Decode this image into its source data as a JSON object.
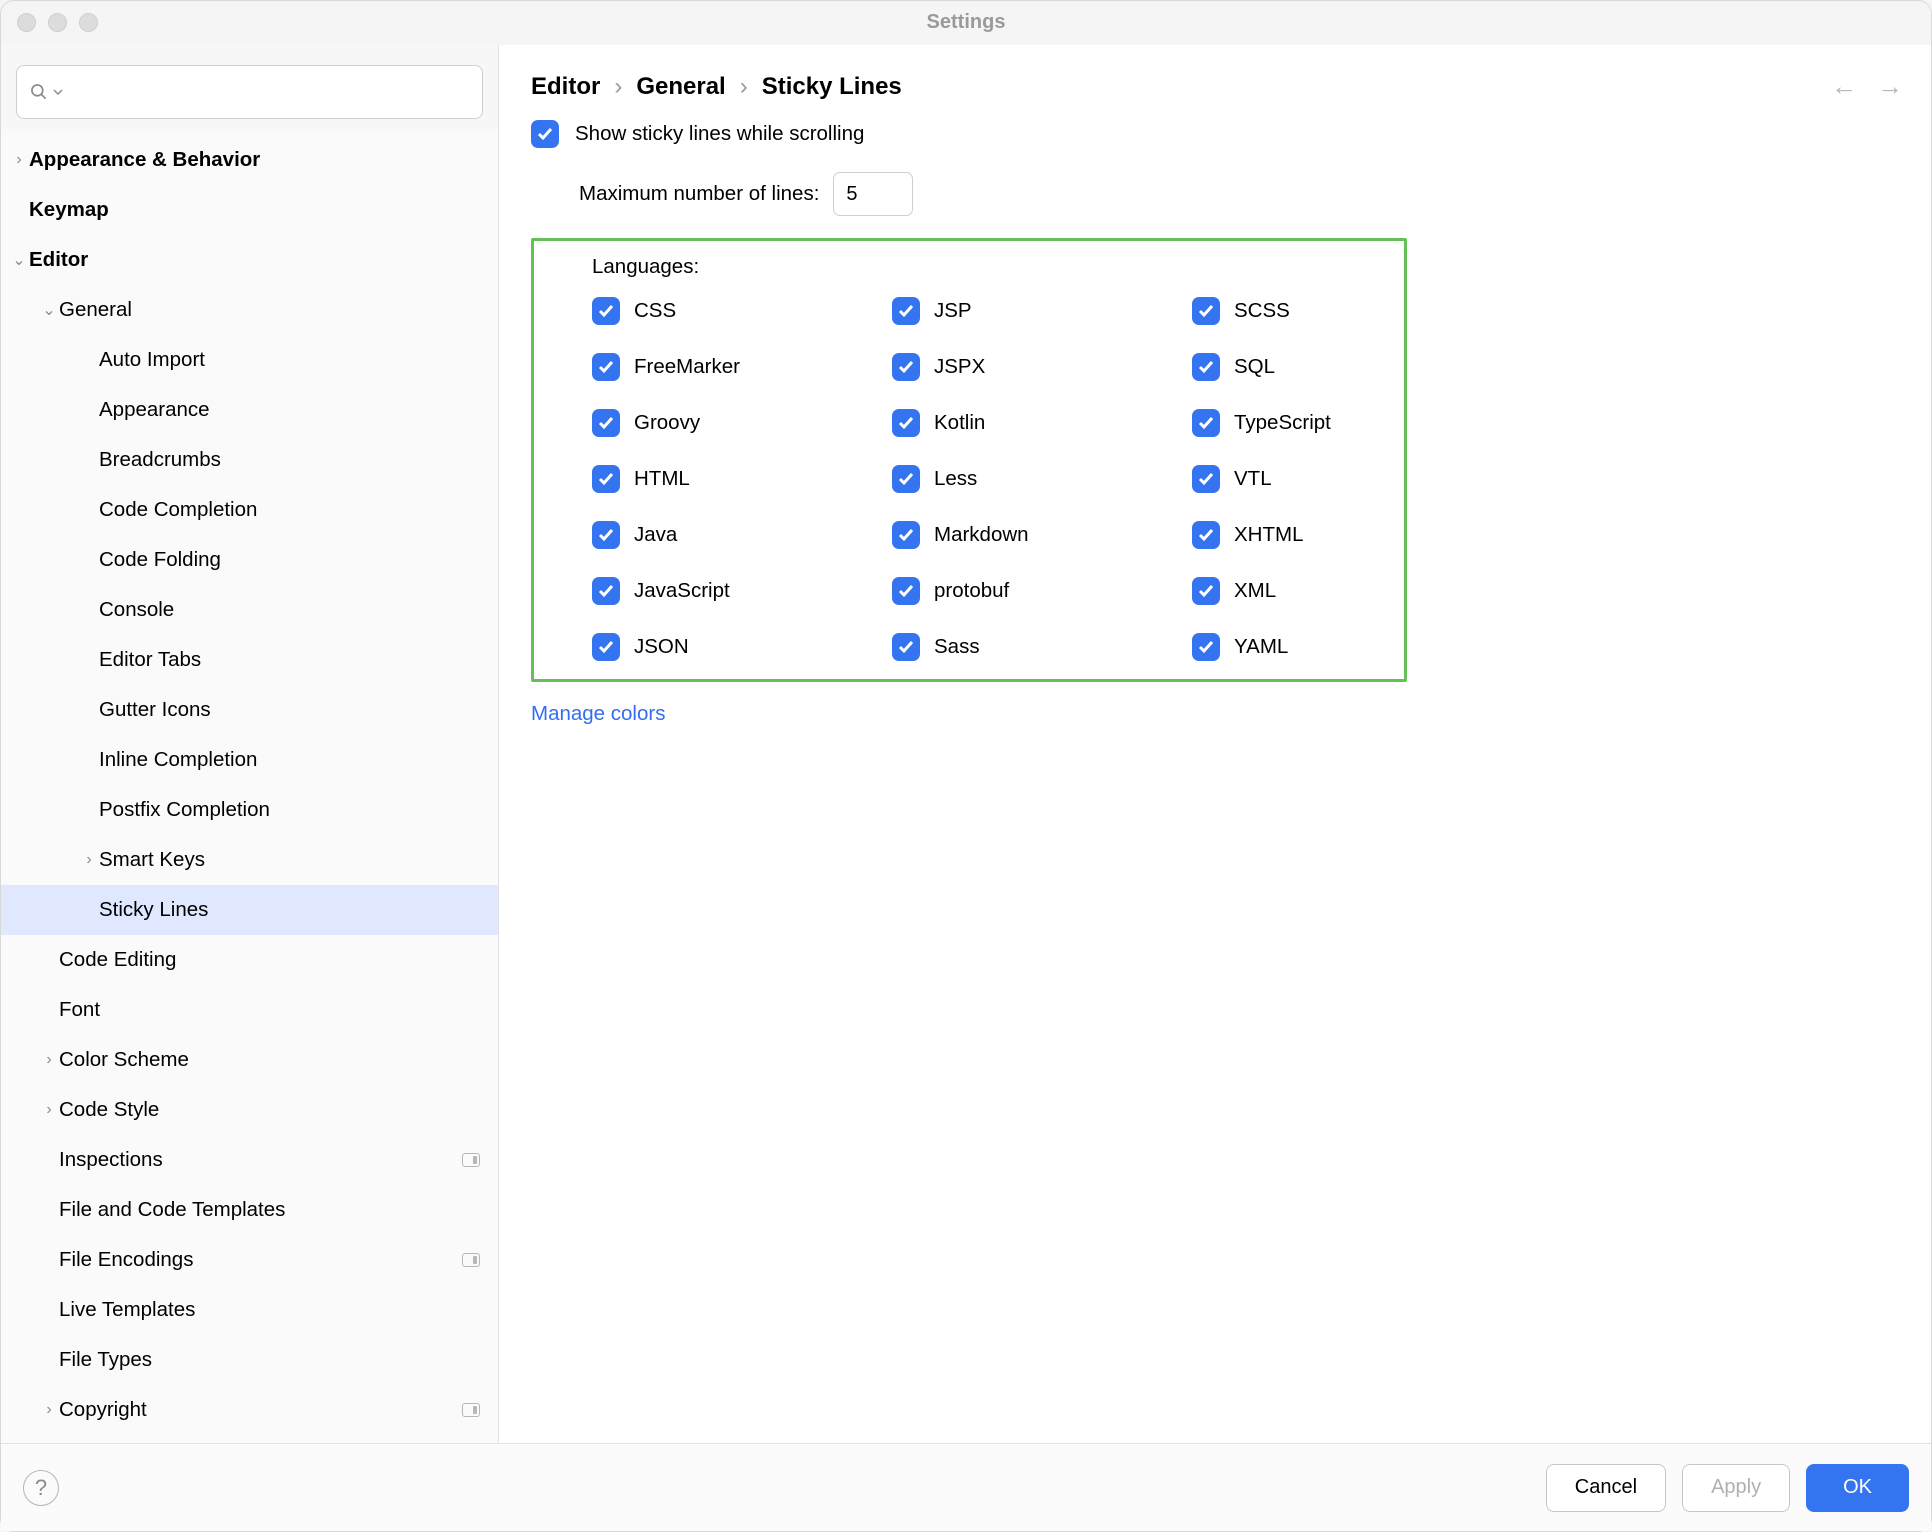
{
  "window": {
    "title": "Settings"
  },
  "search": {
    "placeholder": ""
  },
  "sidebar": {
    "items": [
      {
        "label": "Appearance & Behavior",
        "depth": 0,
        "bold": true,
        "chevron": "right"
      },
      {
        "label": "Keymap",
        "depth": 0,
        "bold": true
      },
      {
        "label": "Editor",
        "depth": 0,
        "bold": true,
        "chevron": "down"
      },
      {
        "label": "General",
        "depth": 1,
        "chevron": "down"
      },
      {
        "label": "Auto Import",
        "depth": 2
      },
      {
        "label": "Appearance",
        "depth": 2
      },
      {
        "label": "Breadcrumbs",
        "depth": 2
      },
      {
        "label": "Code Completion",
        "depth": 2
      },
      {
        "label": "Code Folding",
        "depth": 2
      },
      {
        "label": "Console",
        "depth": 2
      },
      {
        "label": "Editor Tabs",
        "depth": 2
      },
      {
        "label": "Gutter Icons",
        "depth": 2
      },
      {
        "label": "Inline Completion",
        "depth": 2
      },
      {
        "label": "Postfix Completion",
        "depth": 2
      },
      {
        "label": "Smart Keys",
        "depth": 2,
        "chevron": "right"
      },
      {
        "label": "Sticky Lines",
        "depth": 2,
        "selected": true
      },
      {
        "label": "Code Editing",
        "depth": 1
      },
      {
        "label": "Font",
        "depth": 1
      },
      {
        "label": "Color Scheme",
        "depth": 1,
        "chevron": "right"
      },
      {
        "label": "Code Style",
        "depth": 1,
        "chevron": "right"
      },
      {
        "label": "Inspections",
        "depth": 1,
        "badge": true
      },
      {
        "label": "File and Code Templates",
        "depth": 1
      },
      {
        "label": "File Encodings",
        "depth": 1,
        "badge": true
      },
      {
        "label": "Live Templates",
        "depth": 1
      },
      {
        "label": "File Types",
        "depth": 1
      },
      {
        "label": "Copyright",
        "depth": 1,
        "chevron": "right",
        "badge": true
      }
    ]
  },
  "breadcrumb": [
    "Editor",
    "General",
    "Sticky Lines"
  ],
  "content": {
    "show_label": "Show sticky lines while scrolling",
    "show_checked": true,
    "maxlines_label": "Maximum number of lines:",
    "maxlines_value": "5",
    "languages_label": "Languages:",
    "languages": [
      {
        "label": "CSS",
        "checked": true
      },
      {
        "label": "JSP",
        "checked": true
      },
      {
        "label": "SCSS",
        "checked": true
      },
      {
        "label": "FreeMarker",
        "checked": true
      },
      {
        "label": "JSPX",
        "checked": true
      },
      {
        "label": "SQL",
        "checked": true
      },
      {
        "label": "Groovy",
        "checked": true
      },
      {
        "label": "Kotlin",
        "checked": true
      },
      {
        "label": "TypeScript",
        "checked": true
      },
      {
        "label": "HTML",
        "checked": true
      },
      {
        "label": "Less",
        "checked": true
      },
      {
        "label": "VTL",
        "checked": true
      },
      {
        "label": "Java",
        "checked": true
      },
      {
        "label": "Markdown",
        "checked": true
      },
      {
        "label": "XHTML",
        "checked": true
      },
      {
        "label": "JavaScript",
        "checked": true
      },
      {
        "label": "protobuf",
        "checked": true
      },
      {
        "label": "XML",
        "checked": true
      },
      {
        "label": "JSON",
        "checked": true
      },
      {
        "label": "Sass",
        "checked": true
      },
      {
        "label": "YAML",
        "checked": true
      }
    ],
    "manage_colors": "Manage colors"
  },
  "footer": {
    "cancel": "Cancel",
    "apply": "Apply",
    "ok": "OK"
  }
}
